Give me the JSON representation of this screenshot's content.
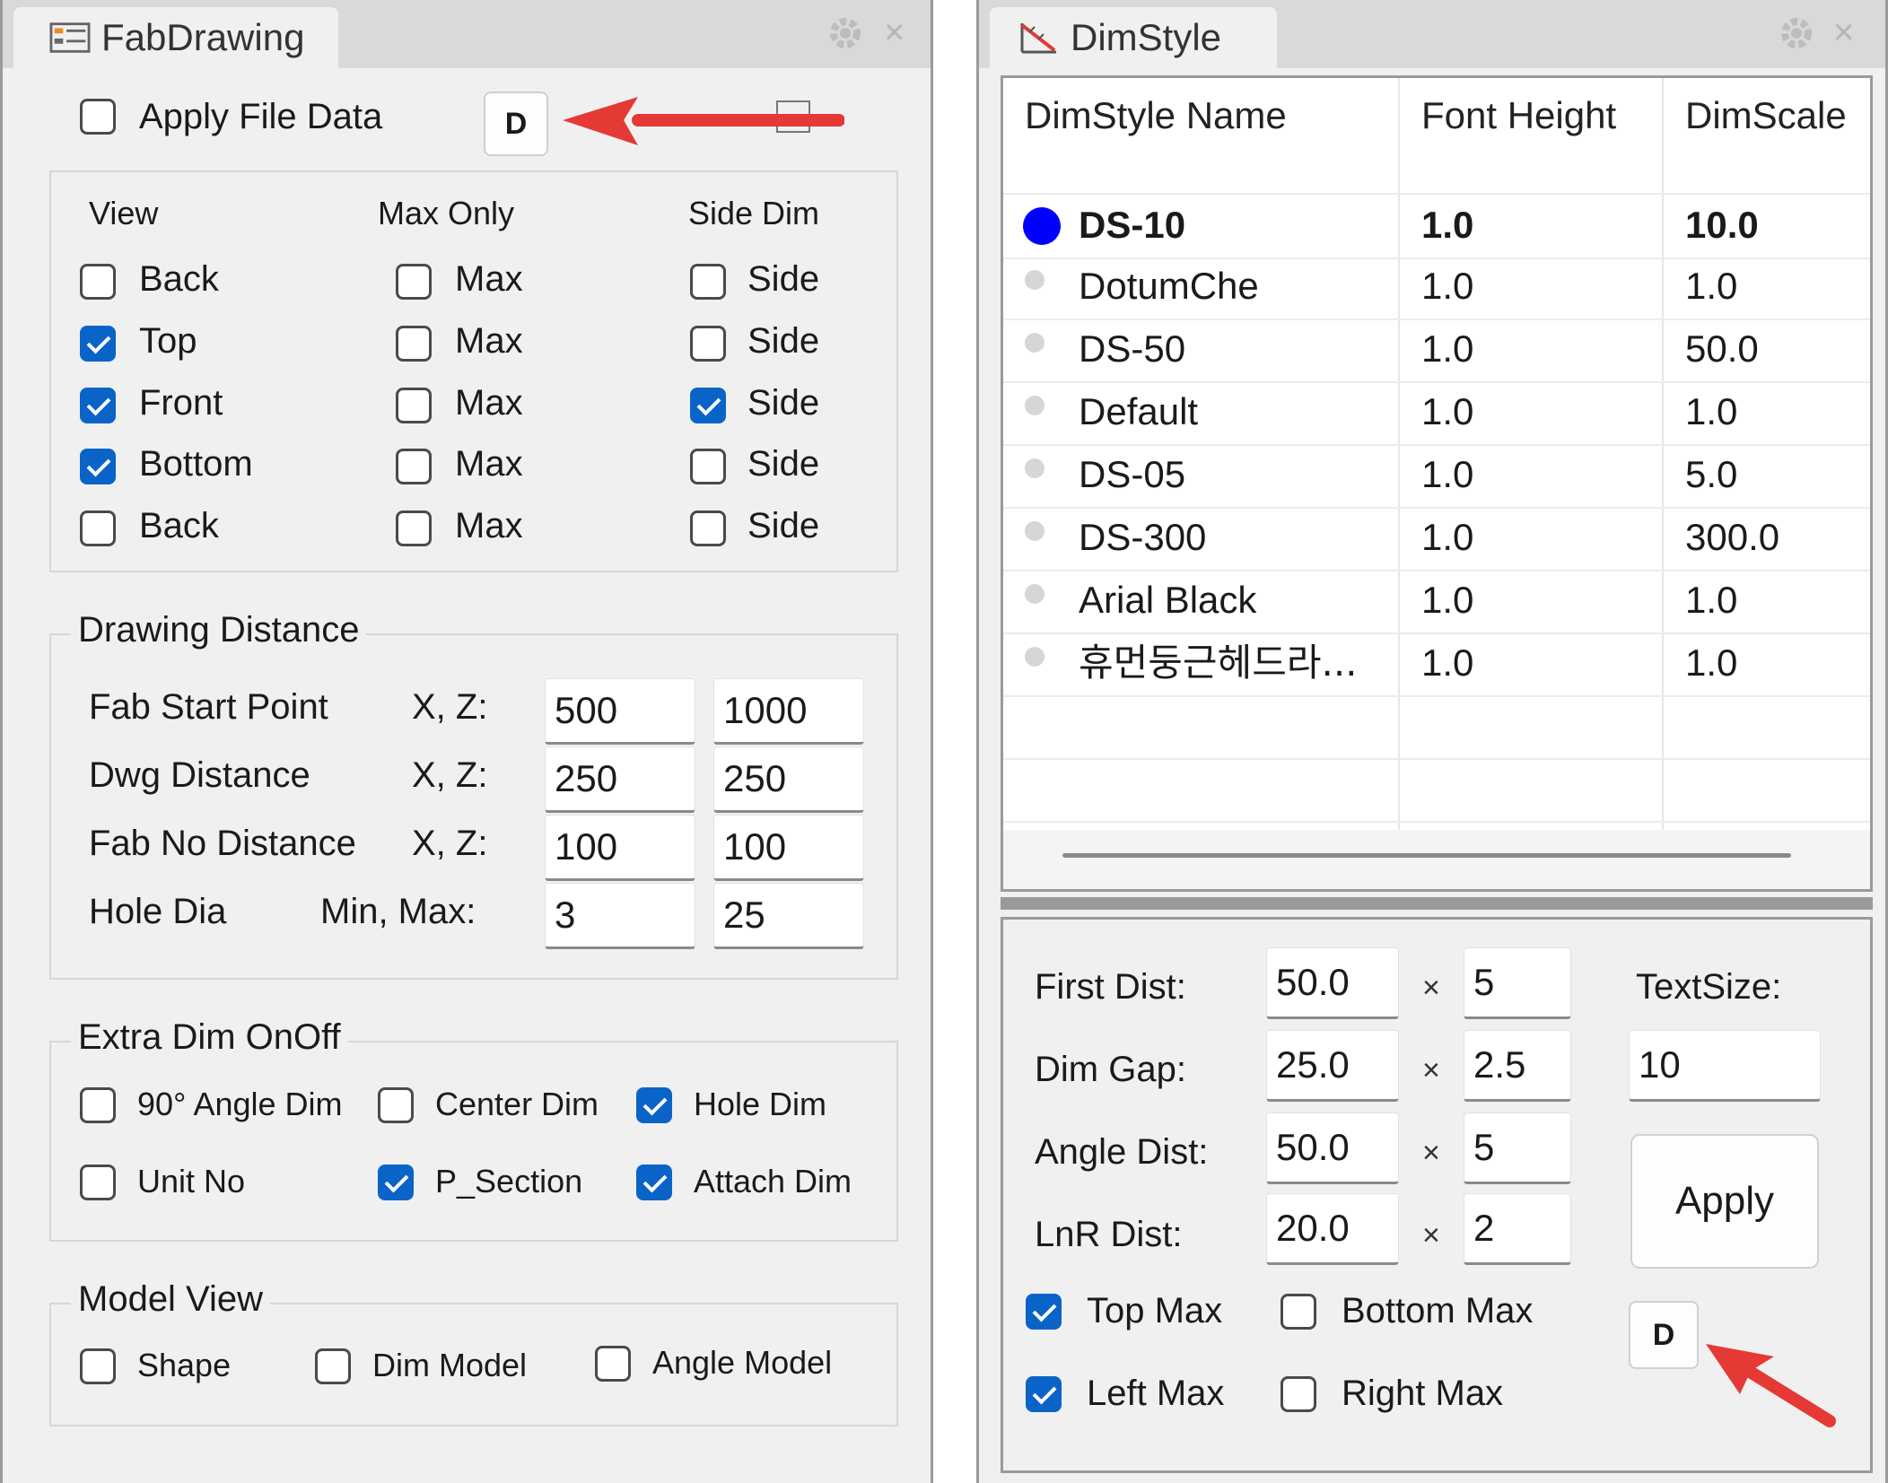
{
  "fab": {
    "tab_title": "FabDrawing",
    "apply_file_data": {
      "label": "Apply File Data",
      "checked": false
    },
    "d_button": "D",
    "view_group": {
      "headers": {
        "view": "View",
        "max_only": "Max Only",
        "side_dim": "Side Dim"
      },
      "rows": [
        {
          "view": "Back",
          "view_checked": false,
          "max": "Max",
          "max_checked": false,
          "side": "Side",
          "side_checked": false
        },
        {
          "view": "Top",
          "view_checked": true,
          "max": "Max",
          "max_checked": false,
          "side": "Side",
          "side_checked": false
        },
        {
          "view": "Front",
          "view_checked": true,
          "max": "Max",
          "max_checked": false,
          "side": "Side",
          "side_checked": true
        },
        {
          "view": "Bottom",
          "view_checked": true,
          "max": "Max",
          "max_checked": false,
          "side": "Side",
          "side_checked": false
        },
        {
          "view": "Back",
          "view_checked": false,
          "max": "Max",
          "max_checked": false,
          "side": "Side",
          "side_checked": false
        }
      ]
    },
    "drawing_distance": {
      "title": "Drawing Distance",
      "rows": [
        {
          "label": "Fab Start Point",
          "axis": "X, Z:",
          "v1": "500",
          "v2": "1000"
        },
        {
          "label": "Dwg Distance",
          "axis": "X, Z:",
          "v1": "250",
          "v2": "250"
        },
        {
          "label": "Fab No Distance",
          "axis": "X, Z:",
          "v1": "100",
          "v2": "100"
        },
        {
          "label": "Hole Dia",
          "axis": "Min, Max:",
          "v1": "3",
          "v2": "25"
        }
      ]
    },
    "extra_dim": {
      "title": "Extra Dim OnOff",
      "items": [
        {
          "label": "90° Angle Dim",
          "checked": false
        },
        {
          "label": "Center Dim",
          "checked": false
        },
        {
          "label": "Hole Dim",
          "checked": true
        },
        {
          "label": "Unit No",
          "checked": false
        },
        {
          "label": "P_Section",
          "checked": true
        },
        {
          "label": "Attach Dim",
          "checked": true
        }
      ]
    },
    "model_view": {
      "title": "Model View",
      "items": [
        {
          "label": "Shape",
          "checked": false
        },
        {
          "label": "Dim Model",
          "checked": false
        },
        {
          "label": "Angle Model",
          "checked": false
        }
      ]
    }
  },
  "dim": {
    "tab_title": "DimStyle",
    "columns": [
      "DimStyle Name",
      "Font Height",
      "DimScale"
    ],
    "rows": [
      {
        "name": "DS-10",
        "font_height": "1.0",
        "dimscale": "10.0",
        "selected": true
      },
      {
        "name": "DotumChe",
        "font_height": "1.0",
        "dimscale": "1.0",
        "selected": false
      },
      {
        "name": "DS-50",
        "font_height": "1.0",
        "dimscale": "50.0",
        "selected": false
      },
      {
        "name": "Default",
        "font_height": "1.0",
        "dimscale": "1.0",
        "selected": false
      },
      {
        "name": "DS-05",
        "font_height": "1.0",
        "dimscale": "5.0",
        "selected": false
      },
      {
        "name": "DS-300",
        "font_height": "1.0",
        "dimscale": "300.0",
        "selected": false
      },
      {
        "name": "Arial Black",
        "font_height": "1.0",
        "dimscale": "1.0",
        "selected": false
      },
      {
        "name": "휴먼둥근헤드라...",
        "font_height": "1.0",
        "dimscale": "1.0",
        "selected": false
      }
    ],
    "params": [
      {
        "label": "First Dist:",
        "value": "50.0",
        "mult": "5"
      },
      {
        "label": "Dim Gap:",
        "value": "25.0",
        "mult": "2.5"
      },
      {
        "label": "Angle Dist:",
        "value": "50.0",
        "mult": "5"
      },
      {
        "label": "LnR Dist:",
        "value": "20.0",
        "mult": "2"
      }
    ],
    "times_symbol": "×",
    "text_size": {
      "label": "TextSize:",
      "value": "10"
    },
    "apply_button": "Apply",
    "d_button": "D",
    "checks": [
      {
        "label": "Top Max",
        "checked": true
      },
      {
        "label": "Bottom Max",
        "checked": false
      },
      {
        "label": "Left Max",
        "checked": true
      },
      {
        "label": "Right Max",
        "checked": false
      }
    ]
  },
  "colors": {
    "accent": "#0a64c8",
    "selected_dot": "#0000ff",
    "arrow": "#e53935"
  },
  "icons": [
    "fabdrawing-list-icon",
    "dimstyle-ruler-icon",
    "gear-icon",
    "close-icon",
    "red-arrow-annotation"
  ]
}
